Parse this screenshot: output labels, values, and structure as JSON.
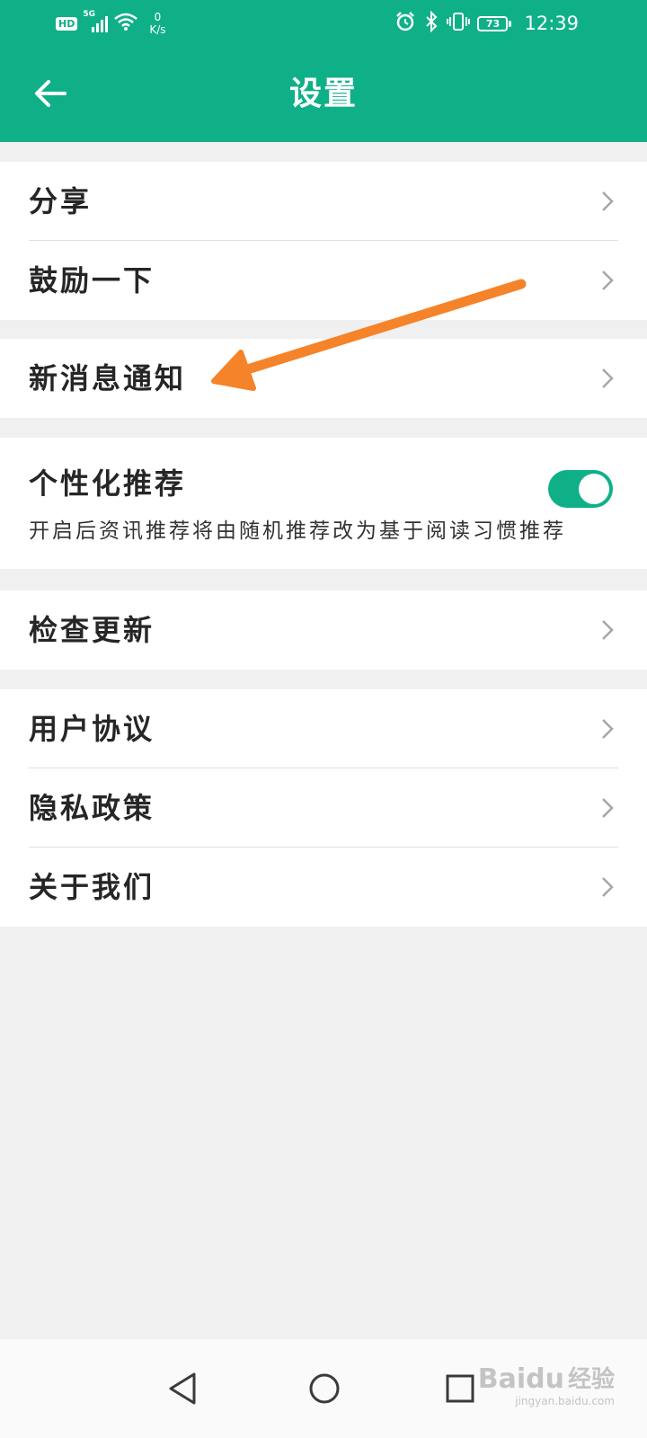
{
  "status_bar": {
    "hd": "HD",
    "network": "5G",
    "net_speed_value": "0",
    "net_speed_unit": "K/s",
    "battery_level": "73",
    "time": "12:39"
  },
  "header": {
    "title": "设置"
  },
  "groups": {
    "share": "分享",
    "encourage": "鼓励一下",
    "notifications": "新消息通知",
    "personalized": {
      "label": "个性化推荐",
      "description": "开启后资讯推荐将由随机推荐改为基于阅读习惯推荐",
      "enabled": true
    },
    "check_update": "检查更新",
    "user_agreement": "用户协议",
    "privacy_policy": "隐私政策",
    "about_us": "关于我们"
  },
  "watermark": {
    "logo": "Baidu",
    "cn": "经验",
    "url": "jingyan.baidu.com"
  },
  "colors": {
    "accent": "#0fb088",
    "arrow": "#f5832a",
    "background": "#f0f0f0"
  }
}
